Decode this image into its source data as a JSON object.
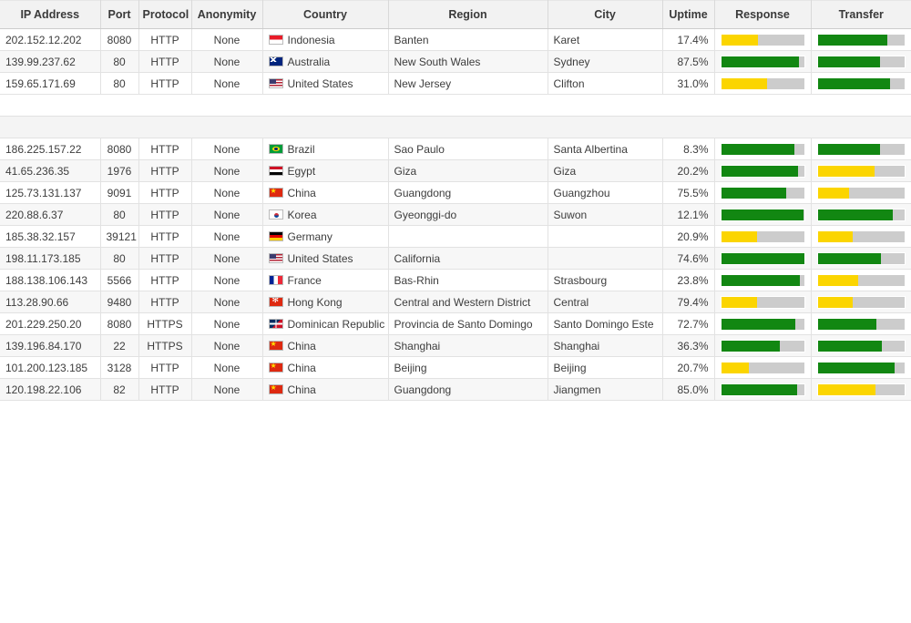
{
  "table": {
    "columns": [
      {
        "key": "ip",
        "label": "IP Address"
      },
      {
        "key": "port",
        "label": "Port"
      },
      {
        "key": "protocol",
        "label": "Protocol"
      },
      {
        "key": "anonymity",
        "label": "Anonymity"
      },
      {
        "key": "country",
        "label": "Country"
      },
      {
        "key": "region",
        "label": "Region"
      },
      {
        "key": "city",
        "label": "City"
      },
      {
        "key": "uptime",
        "label": "Uptime"
      },
      {
        "key": "response",
        "label": "Response"
      },
      {
        "key": "transfer",
        "label": "Transfer"
      }
    ],
    "colors": {
      "bar_green": "#128712",
      "bar_yellow": "#fbd500",
      "bar_track": "#cccccc",
      "header_bg": "#f2f2f2",
      "row_alt_bg": "#f7f7f7",
      "gap_bg": "#f4f4f4"
    },
    "top_rows": [
      {
        "ip": "202.152.12.202",
        "port": "8080",
        "protocol": "HTTP",
        "anonymity": "None",
        "country": "Indonesia",
        "flag": "flag-indonesia",
        "region": "Banten",
        "city": "Karet",
        "uptime": "17.4%",
        "response": {
          "pct": 45,
          "color": "yellow"
        },
        "transfer": {
          "pct": 80,
          "color": "green"
        }
      },
      {
        "ip": "139.99.237.62",
        "port": "80",
        "protocol": "HTTP",
        "anonymity": "None",
        "country": "Australia",
        "flag": "flag-australia",
        "region": "New South Wales",
        "city": "Sydney",
        "uptime": "87.5%",
        "response": {
          "pct": 94,
          "color": "green"
        },
        "transfer": {
          "pct": 72,
          "color": "green"
        }
      },
      {
        "ip": "159.65.171.69",
        "port": "80",
        "protocol": "HTTP",
        "anonymity": "None",
        "country": "United States",
        "flag": "flag-usa",
        "region": "New Jersey",
        "city": "Clifton",
        "uptime": "31.0%",
        "response": {
          "pct": 55,
          "color": "yellow"
        },
        "transfer": {
          "pct": 83,
          "color": "green"
        }
      }
    ],
    "bottom_rows": [
      {
        "ip": "186.225.157.22",
        "port": "8080",
        "protocol": "HTTP",
        "anonymity": "None",
        "country": "Brazil",
        "flag": "flag-brazil",
        "region": "Sao Paulo",
        "city": "Santa Albertina",
        "uptime": "8.3%",
        "response": {
          "pct": 88,
          "color": "green"
        },
        "transfer": {
          "pct": 72,
          "color": "green"
        }
      },
      {
        "ip": "41.65.236.35",
        "port": "1976",
        "protocol": "HTTP",
        "anonymity": "None",
        "country": "Egypt",
        "flag": "flag-egypt",
        "region": "Giza",
        "city": "Giza",
        "uptime": "20.2%",
        "response": {
          "pct": 93,
          "color": "green"
        },
        "transfer": {
          "pct": 65,
          "color": "yellow"
        }
      },
      {
        "ip": "125.73.131.137",
        "port": "9091",
        "protocol": "HTTP",
        "anonymity": "None",
        "country": "China",
        "flag": "flag-china",
        "region": "Guangdong",
        "city": "Guangzhou",
        "uptime": "75.5%",
        "response": {
          "pct": 79,
          "color": "green"
        },
        "transfer": {
          "pct": 36,
          "color": "yellow"
        }
      },
      {
        "ip": "220.88.6.37",
        "port": "80",
        "protocol": "HTTP",
        "anonymity": "None",
        "country": "Korea",
        "flag": "flag-korea",
        "region": "Gyeonggi-do",
        "city": "Suwon",
        "uptime": "12.1%",
        "response": {
          "pct": 99,
          "color": "green"
        },
        "transfer": {
          "pct": 86,
          "color": "green"
        }
      },
      {
        "ip": "185.38.32.157",
        "port": "39121",
        "protocol": "HTTP",
        "anonymity": "None",
        "country": "Germany",
        "flag": "flag-germany",
        "region": "",
        "city": "",
        "uptime": "20.9%",
        "response": {
          "pct": 43,
          "color": "yellow"
        },
        "transfer": {
          "pct": 40,
          "color": "yellow"
        }
      },
      {
        "ip": "198.11.173.185",
        "port": "80",
        "protocol": "HTTP",
        "anonymity": "None",
        "country": "United States",
        "flag": "flag-usa",
        "region": "California",
        "city": "",
        "uptime": "74.6%",
        "response": {
          "pct": 100,
          "color": "green"
        },
        "transfer": {
          "pct": 73,
          "color": "green"
        }
      },
      {
        "ip": "188.138.106.143",
        "port": "5566",
        "protocol": "HTTP",
        "anonymity": "None",
        "country": "France",
        "flag": "flag-france",
        "region": "Bas-Rhin",
        "city": "Strasbourg",
        "uptime": "23.8%",
        "response": {
          "pct": 95,
          "color": "green"
        },
        "transfer": {
          "pct": 47,
          "color": "yellow"
        }
      },
      {
        "ip": "113.28.90.66",
        "port": "9480",
        "protocol": "HTTP",
        "anonymity": "None",
        "country": "Hong Kong",
        "flag": "flag-hongkong",
        "region": "Central and Western District",
        "city": "Central",
        "uptime": "79.4%",
        "response": {
          "pct": 43,
          "color": "yellow"
        },
        "transfer": {
          "pct": 40,
          "color": "yellow"
        }
      },
      {
        "ip": "201.229.250.20",
        "port": "8080",
        "protocol": "HTTPS",
        "anonymity": "None",
        "country": "Dominican Republic",
        "flag": "flag-dominican",
        "region": "Provincia de Santo Domingo",
        "city": "Santo Domingo Este",
        "uptime": "72.7%",
        "response": {
          "pct": 90,
          "color": "green"
        },
        "transfer": {
          "pct": 68,
          "color": "green"
        }
      },
      {
        "ip": "139.196.84.170",
        "port": "22",
        "protocol": "HTTPS",
        "anonymity": "None",
        "country": "China",
        "flag": "flag-china",
        "region": "Shanghai",
        "city": "Shanghai",
        "uptime": "36.3%",
        "response": {
          "pct": 71,
          "color": "green"
        },
        "transfer": {
          "pct": 74,
          "color": "green"
        }
      },
      {
        "ip": "101.200.123.185",
        "port": "3128",
        "protocol": "HTTP",
        "anonymity": "None",
        "country": "China",
        "flag": "flag-china",
        "region": "Beijing",
        "city": "Beijing",
        "uptime": "20.7%",
        "response": {
          "pct": 34,
          "color": "yellow"
        },
        "transfer": {
          "pct": 89,
          "color": "green"
        }
      },
      {
        "ip": "120.198.22.106",
        "port": "82",
        "protocol": "HTTP",
        "anonymity": "None",
        "country": "China",
        "flag": "flag-china",
        "region": "Guangdong",
        "city": "Jiangmen",
        "uptime": "85.0%",
        "response": {
          "pct": 92,
          "color": "green"
        },
        "transfer": {
          "pct": 66,
          "color": "yellow"
        }
      }
    ]
  }
}
